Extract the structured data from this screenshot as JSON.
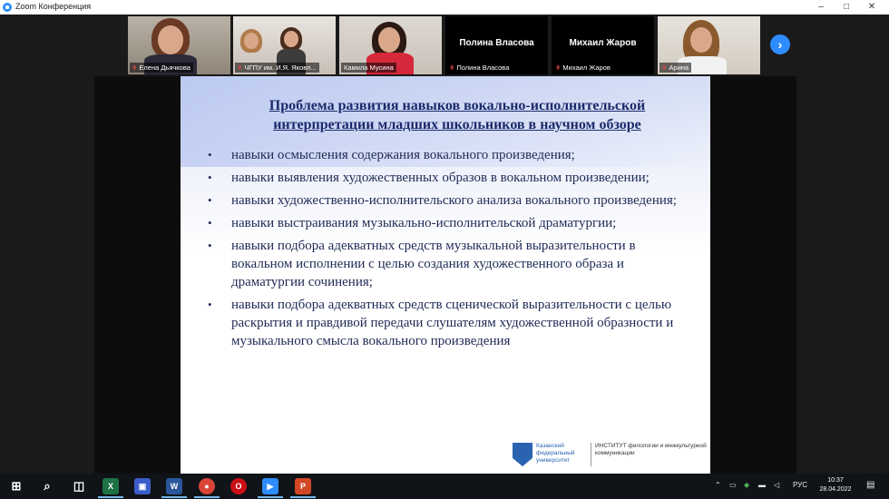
{
  "window": {
    "title": "Zoom Конференция",
    "minimize_glyph": "–",
    "restore_glyph": "□",
    "close_glyph": "✕"
  },
  "participants": [
    {
      "name": "Елена Дьячкова",
      "video": true
    },
    {
      "name": "ЧГПУ им. И.Я. Яковл...",
      "video": true
    },
    {
      "name": "Камила Мусина",
      "video": true,
      "active_speaker": true
    },
    {
      "name": "Полина Власова",
      "video": false
    },
    {
      "name": "Михаил Жаров",
      "video": false
    },
    {
      "name": "Арина",
      "video": true
    }
  ],
  "gallery_next_glyph": "›",
  "slide": {
    "title_line1": "Проблема развития навыков вокально-исполнительской",
    "title_line2": "интерпретации младших школьников в научном обзоре",
    "bullets": [
      "навыки осмысления содержания вокального произведения;",
      "навыки выявления художественных образов в вокальном произведении;",
      "навыки  художественно-исполнительского анализа вокального произведения;",
      "навыки выстраивания музыкально-исполнительской драматургии;",
      "навыки подбора адекватных средств музыкальной выразительности в вокальном исполнении с целью создания художественного образа и драматургии сочинения;",
      "навыки подбора адекватных средств сценической выразительности с целью раскрытия  и правдивой передачи слушателям художественной образности и музыкального смысла вокального произведения"
    ],
    "logo_left": "Казанский федеральный университет",
    "logo_right": "ИНСТИТУТ филологии и межкультурной коммуникации"
  },
  "taskbar": {
    "apps": [
      {
        "icon": "windows-start-icon",
        "label": "⊞",
        "color": "#ffffff"
      },
      {
        "icon": "search-icon",
        "label": "⌕",
        "color": "#ffffff"
      },
      {
        "icon": "task-view-icon",
        "label": "◫",
        "color": "#ffffff"
      },
      {
        "icon": "excel-icon",
        "label": "X",
        "color": "#1e7145"
      },
      {
        "icon": "save-icon",
        "label": "▣",
        "color": "#3b5ccc"
      },
      {
        "icon": "word-icon",
        "label": "W",
        "color": "#2b579a"
      },
      {
        "icon": "chrome-icon",
        "label": "●",
        "color": "#db4437"
      },
      {
        "icon": "opera-icon",
        "label": "O",
        "color": "#cc0f16"
      },
      {
        "icon": "zoom-icon",
        "label": "▶",
        "color": "#2d8cff"
      },
      {
        "icon": "powerpoint-icon",
        "label": "P",
        "color": "#d24726"
      }
    ],
    "tray": {
      "chevron": "⌃",
      "lang": "РУС",
      "time": "10:37",
      "date": "28.04.2022"
    }
  }
}
